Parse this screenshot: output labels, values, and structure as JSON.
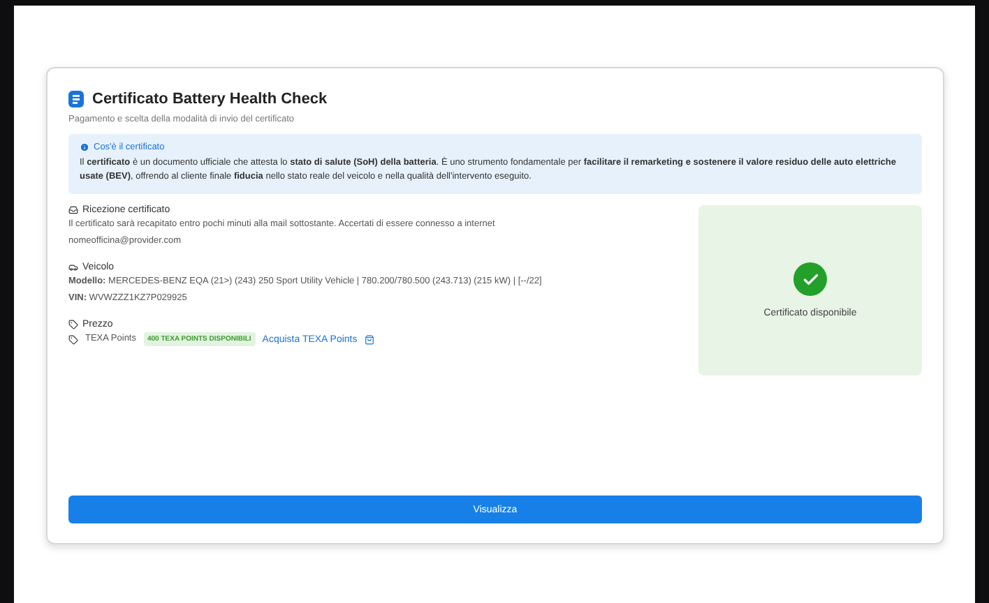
{
  "header": {
    "title": "Certificato Battery Health Check",
    "subtitle": "Pagamento e scelta della modalità di invio del certificato"
  },
  "info": {
    "title": "Cos'è il certificato",
    "text": "Il **certificato** è un documento ufficiale che attesta lo **stato di salute (SoH) della batteria**. È uno strumento fondamentale per **facilitare il remarketing e sostenere il valore residuo delle auto elettriche usate (BEV)**, offrendo al cliente finale **fiducia** nello stato reale del veicolo e nella qualità dell'intervento eseguito."
  },
  "reception": {
    "title": "Ricezione certificato",
    "text": "Il certificato sarà recapitato entro pochi minuti alla mail sottostante. Accertati di essere connesso a internet",
    "email": "nomeofficina@provider.com"
  },
  "vehicle": {
    "title": "Veicolo",
    "model": "**Modello:** MERCEDES-BENZ EQA (21>) (243) 250 Sport Utility Vehicle | 780.200/780.500 (243.713) (215 kW) | [--/22]",
    "vin": "**VIN:** WVWZZZ1KZ7P029925"
  },
  "price": {
    "title": "Prezzo",
    "points_label": "TEXA Points",
    "badge": "400 TEXA POINTS DISPONIBILI",
    "link": "Acquista TEXA Points"
  },
  "status": {
    "available": true,
    "label": "Certificato disponibile"
  },
  "button": "Visualizza"
}
